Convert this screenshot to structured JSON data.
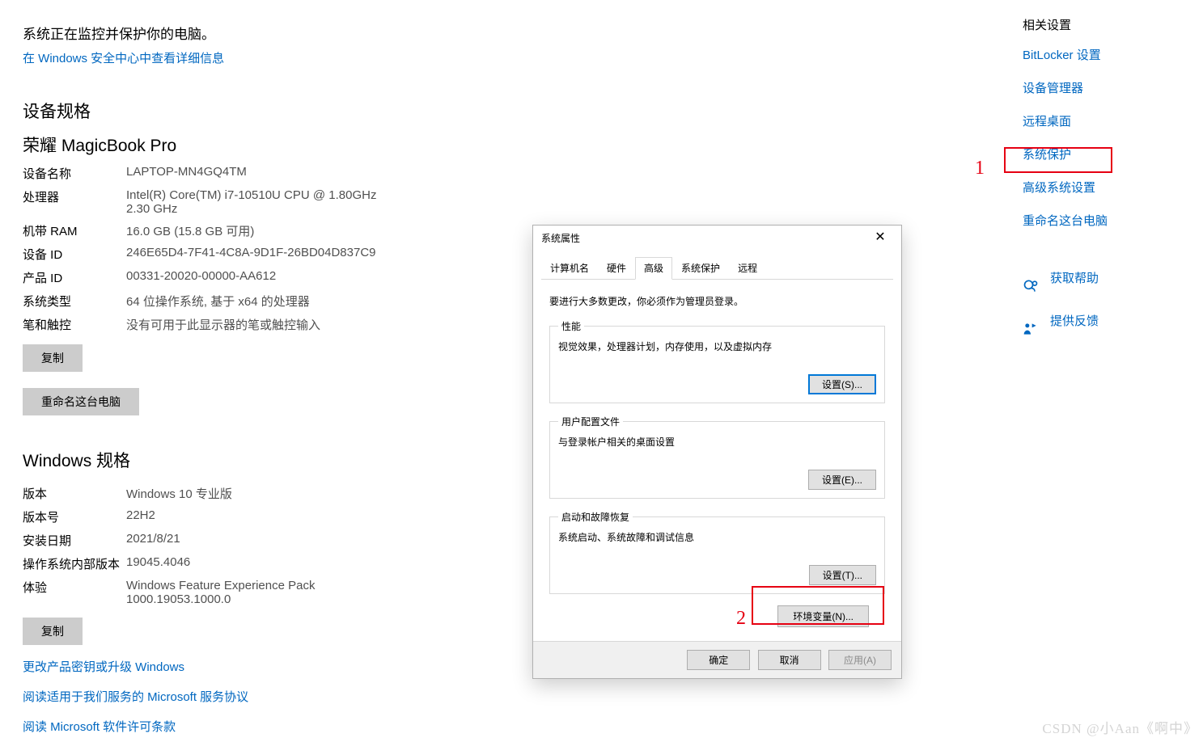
{
  "header": {
    "status": "系统正在监控并保护你的电脑。",
    "detail_link": "在 Windows 安全中心中查看详细信息"
  },
  "device_spec": {
    "section_title": "设备规格",
    "product_name": "荣耀 MagicBook Pro",
    "rows": {
      "device_name_label": "设备名称",
      "device_name": "LAPTOP-MN4GQ4TM",
      "cpu_label": "处理器",
      "cpu": "Intel(R) Core(TM) i7-10510U CPU @ 1.80GHz   2.30 GHz",
      "ram_label": "机带 RAM",
      "ram": "16.0 GB (15.8 GB 可用)",
      "device_id_label": "设备 ID",
      "device_id": "246E65D4-7F41-4C8A-9D1F-26BD04D837C9",
      "product_id_label": "产品 ID",
      "product_id": "00331-20020-00000-AA612",
      "sys_type_label": "系统类型",
      "sys_type": "64 位操作系统, 基于 x64 的处理器",
      "pen_label": "笔和触控",
      "pen": "没有可用于此显示器的笔或触控输入"
    },
    "copy_btn": "复制",
    "rename_btn": "重命名这台电脑"
  },
  "win_spec": {
    "section_title": "Windows 规格",
    "rows": {
      "edition_label": "版本",
      "edition": "Windows 10 专业版",
      "version_label": "版本号",
      "version": "22H2",
      "install_label": "安装日期",
      "install": "2021/8/21",
      "build_label": "操作系统内部版本",
      "build": "19045.4046",
      "experience_label": "体验",
      "experience": "Windows Feature Experience Pack 1000.19053.1000.0"
    },
    "copy_btn": "复制"
  },
  "bottom_links": {
    "change_key": "更改产品密钥或升级 Windows",
    "read_services": "阅读适用于我们服务的 Microsoft 服务协议",
    "read_license": "阅读 Microsoft 软件许可条款"
  },
  "right": {
    "related_heading": "相关设置",
    "links": {
      "bitlocker": "BitLocker 设置",
      "device_manager": "设备管理器",
      "remote_desktop": "远程桌面",
      "system_protect": "系统保护",
      "advanced": "高级系统设置",
      "rename": "重命名这台电脑"
    },
    "help": "获取帮助",
    "feedback": "提供反馈"
  },
  "annotations": {
    "one": "1",
    "two": "2"
  },
  "dialog": {
    "title": "系统属性",
    "tabs": {
      "computer_name": "计算机名",
      "hardware": "硬件",
      "advanced": "高级",
      "system_protect": "系统保护",
      "remote": "远程"
    },
    "note": "要进行大多数更改，你必须作为管理员登录。",
    "perf": {
      "legend": "性能",
      "desc": "视觉效果，处理器计划，内存使用，以及虚拟内存",
      "btn": "设置(S)..."
    },
    "profile": {
      "legend": "用户配置文件",
      "desc": "与登录帐户相关的桌面设置",
      "btn": "设置(E)..."
    },
    "startup": {
      "legend": "启动和故障恢复",
      "desc": "系统启动、系统故障和调试信息",
      "btn": "设置(T)..."
    },
    "env_btn": "环境变量(N)...",
    "ok": "确定",
    "cancel": "取消",
    "apply": "应用(A)"
  },
  "watermark": "CSDN @小Aan《啊中》"
}
